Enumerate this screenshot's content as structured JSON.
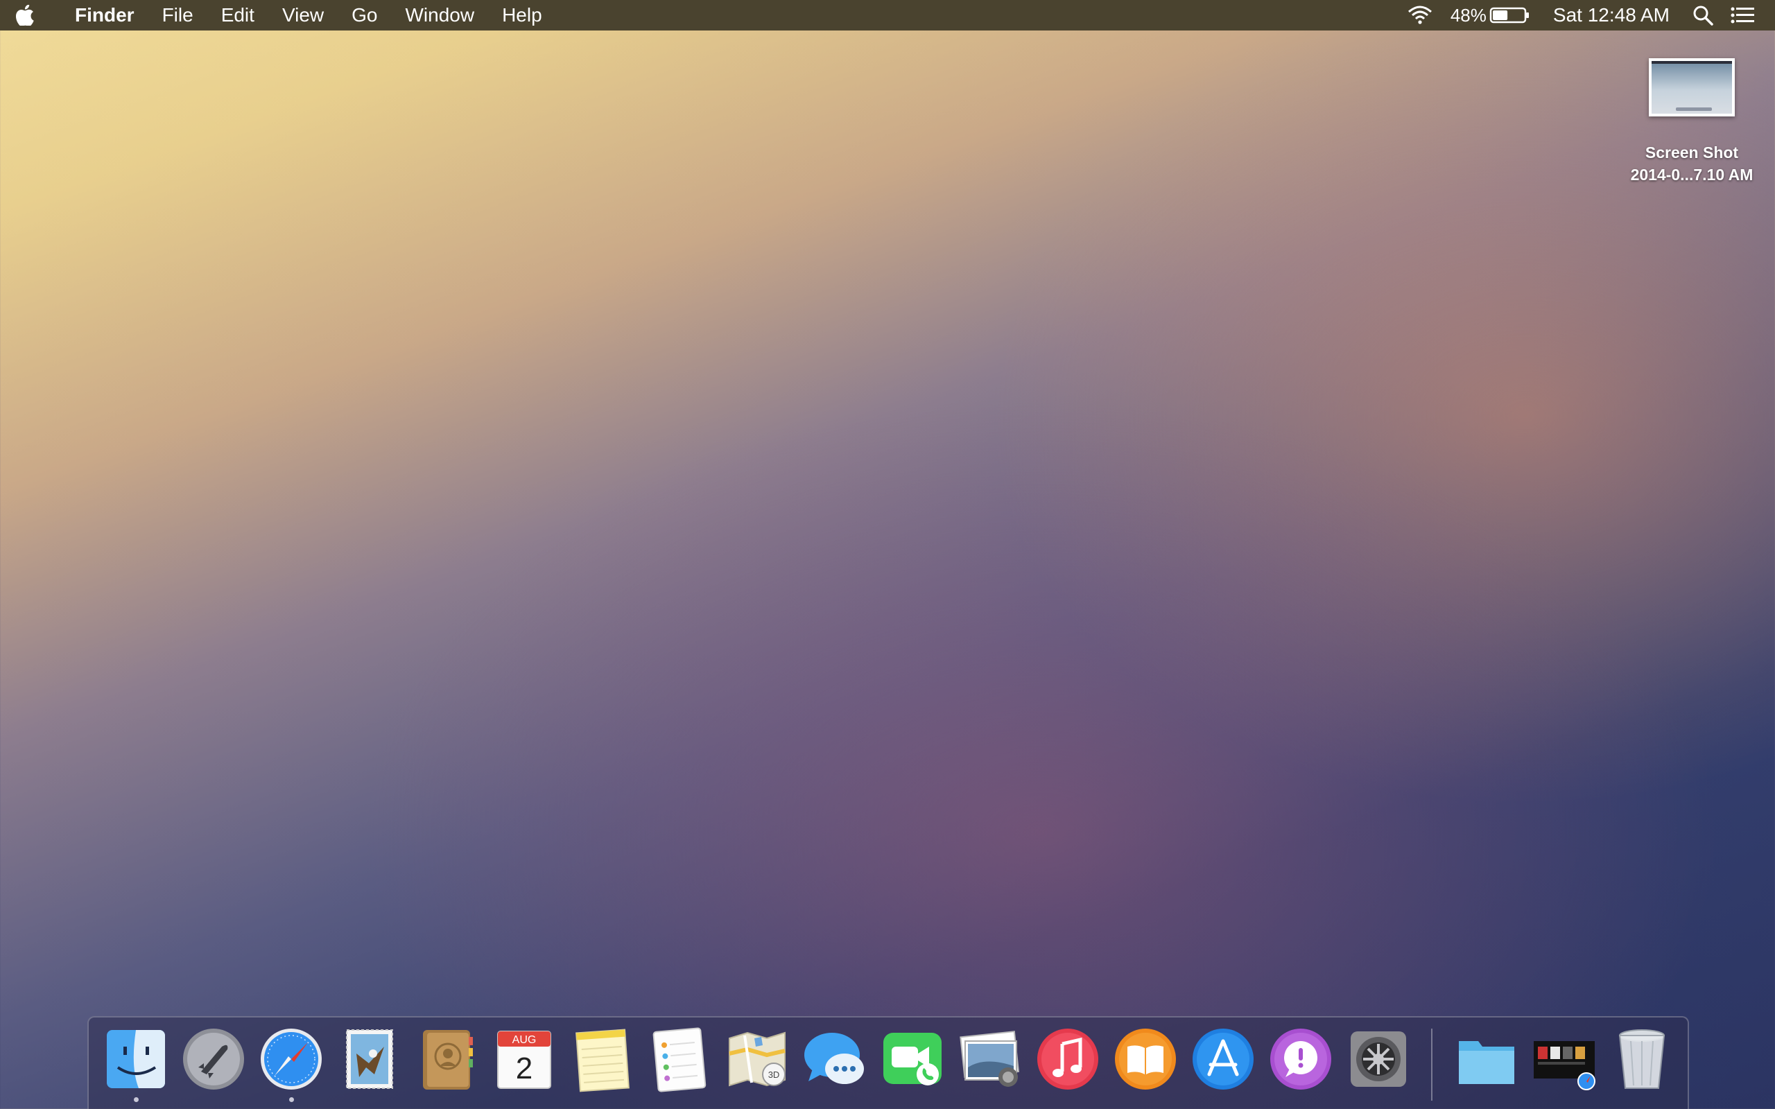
{
  "menubar": {
    "apple_icon": "apple-logo-icon",
    "app_name": "Finder",
    "menus": [
      "File",
      "Edit",
      "View",
      "Go",
      "Window",
      "Help"
    ],
    "status": {
      "wifi_icon": "wifi-icon",
      "battery_percent": "48%",
      "battery_level": 0.48,
      "clock": "Sat 12:48 AM",
      "spotlight_icon": "search-icon",
      "notification_icon": "list-icon"
    }
  },
  "desktop": {
    "files": [
      {
        "name_line1": "Screen Shot",
        "name_line2": "2014-0...7.10 AM",
        "icon": "screenshot-thumbnail"
      }
    ]
  },
  "dock": {
    "apps": [
      {
        "name": "Finder",
        "icon": "finder-icon",
        "running": true
      },
      {
        "name": "Launchpad",
        "icon": "launchpad-rocket-icon",
        "running": false
      },
      {
        "name": "Safari",
        "icon": "safari-compass-icon",
        "running": true
      },
      {
        "name": "Mail",
        "icon": "mail-stamp-icon",
        "running": false
      },
      {
        "name": "Contacts",
        "icon": "contacts-book-icon",
        "running": false
      },
      {
        "name": "Calendar",
        "icon": "calendar-icon",
        "running": false,
        "month": "AUG",
        "day": "2"
      },
      {
        "name": "Notes",
        "icon": "notes-icon",
        "running": false
      },
      {
        "name": "Reminders",
        "icon": "reminders-icon",
        "running": false
      },
      {
        "name": "Maps",
        "icon": "maps-icon",
        "running": false,
        "badge": "3D"
      },
      {
        "name": "Messages",
        "icon": "messages-bubble-icon",
        "running": false
      },
      {
        "name": "FaceTime",
        "icon": "facetime-camera-icon",
        "running": false
      },
      {
        "name": "Photo Booth",
        "icon": "photos-icon",
        "running": false
      },
      {
        "name": "iTunes",
        "icon": "itunes-music-note-icon",
        "running": false
      },
      {
        "name": "iBooks",
        "icon": "ibooks-icon",
        "running": false
      },
      {
        "name": "App Store",
        "icon": "app-store-icon",
        "running": false
      },
      {
        "name": "Feedback Assistant",
        "icon": "feedback-exclamation-icon",
        "running": false
      },
      {
        "name": "System Preferences",
        "icon": "gear-icon",
        "running": false
      }
    ],
    "stacks": [
      {
        "name": "Documents",
        "icon": "folder-icon"
      },
      {
        "name": "Downloads",
        "icon": "downloads-stack-icon"
      },
      {
        "name": "Trash",
        "icon": "trash-icon"
      }
    ]
  }
}
